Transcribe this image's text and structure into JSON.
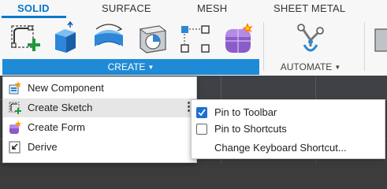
{
  "ribbon": {
    "tabs": [
      {
        "label": "SOLID",
        "active": true
      },
      {
        "label": "SURFACE",
        "active": false
      },
      {
        "label": "MESH",
        "active": false
      },
      {
        "label": "SHEET METAL",
        "active": false
      }
    ],
    "tools": [
      {
        "icon": "create-sketch-icon"
      },
      {
        "icon": "extrude-icon"
      },
      {
        "icon": "revolve-icon"
      },
      {
        "icon": "hole-icon"
      },
      {
        "icon": "pattern-icon"
      },
      {
        "icon": "form-icon"
      },
      {
        "icon": "automate-icon"
      }
    ],
    "create_label": "CREATE",
    "automate_label": "AUTOMATE",
    "accent_color": "#0a78c8",
    "create_bar_color": "#1f8bd6"
  },
  "create_menu": {
    "items": [
      {
        "label": "New Component",
        "icon": "new-component-icon"
      },
      {
        "label": "Create Sketch",
        "icon": "create-sketch-icon",
        "highlighted": true
      },
      {
        "label": "Create Form",
        "icon": "create-form-icon"
      },
      {
        "label": "Derive",
        "icon": "derive-icon"
      }
    ],
    "more_glyph": "⋮"
  },
  "submenu": {
    "items": [
      {
        "label": "Pin to Toolbar",
        "checked": true
      },
      {
        "label": "Pin to Shortcuts",
        "checked": false
      },
      {
        "label": "Change Keyboard Shortcut...",
        "checkbox": false
      }
    ]
  }
}
